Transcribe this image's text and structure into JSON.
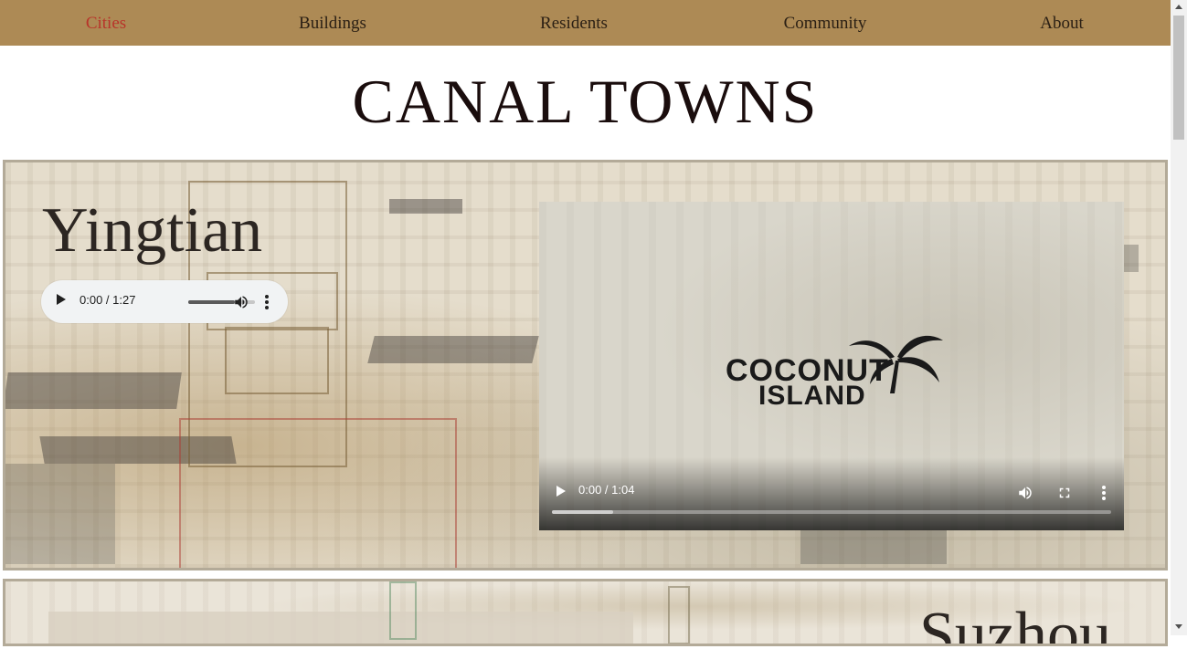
{
  "nav": {
    "items": [
      {
        "label": "Cities",
        "active": true
      },
      {
        "label": "Buildings",
        "active": false
      },
      {
        "label": "Residents",
        "active": false
      },
      {
        "label": "Community",
        "active": false
      },
      {
        "label": "About",
        "active": false
      }
    ]
  },
  "page_title": "CANAL TOWNS",
  "cities": [
    {
      "name": "Yingtian",
      "audio": {
        "time": "0:00 / 1:27",
        "volume_fraction": 0.7
      },
      "video": {
        "time": "0:00 / 1:04",
        "progress_fraction": 0.11,
        "logo_line1": "COCONUT",
        "logo_line2": "ISLAND"
      }
    },
    {
      "name": "Suzhou"
    }
  ],
  "icons": {
    "audio_play": "play-icon",
    "audio_volume": "volume-icon",
    "audio_more": "more-vert-icon",
    "video_play": "play-icon",
    "video_volume": "volume-icon",
    "video_fullscreen": "fullscreen-icon",
    "video_more": "more-vert-icon"
  },
  "colors": {
    "nav_bg": "#ad8a55",
    "nav_active": "#b8342a",
    "title": "#1a0d0d"
  }
}
